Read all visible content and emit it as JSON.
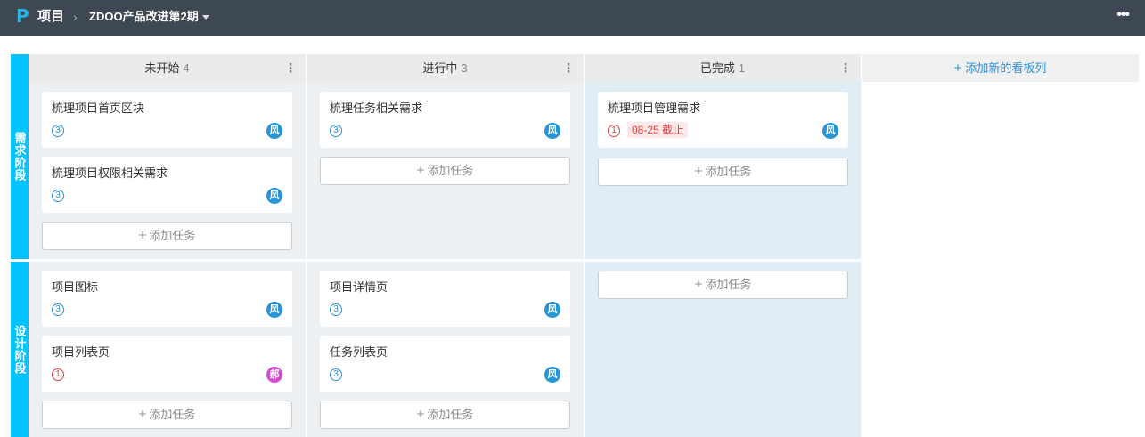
{
  "topbar": {
    "logo": "P",
    "title": "项目",
    "separator": "›",
    "project": "ZDOO产品改进第2期",
    "more": "•••"
  },
  "columns": [
    {
      "name": "未开始",
      "count": "4",
      "menu": "⋮"
    },
    {
      "name": "进行中",
      "count": "3",
      "menu": "⋮"
    },
    {
      "name": "已完成",
      "count": "1",
      "menu": "⋮"
    }
  ],
  "add_column": "添加新的看板列",
  "add_task_label": "添加任务",
  "lanes": [
    {
      "name": "需求阶段",
      "cells": [
        {
          "cards": [
            {
              "title": "梳理项目首页区块",
              "priority": "3",
              "avatar": "风"
            },
            {
              "title": "梳理项目权限相关需求",
              "priority": "3",
              "avatar": "风"
            }
          ]
        },
        {
          "cards": [
            {
              "title": "梳理任务相关需求",
              "priority": "3",
              "avatar": "风"
            }
          ]
        },
        {
          "cards": [
            {
              "title": "梳理项目管理需求",
              "priority": "1",
              "deadline": "08-25 截止",
              "avatar": "风"
            }
          ]
        }
      ]
    },
    {
      "name": "设计阶段",
      "cells": [
        {
          "cards": [
            {
              "title": "项目图标",
              "priority": "3",
              "avatar": "风"
            },
            {
              "title": "项目列表页",
              "priority": "1",
              "avatar": "郝"
            }
          ]
        },
        {
          "cards": [
            {
              "title": "项目详情页",
              "priority": "3",
              "avatar": "风"
            },
            {
              "title": "任务列表页",
              "priority": "3",
              "avatar": "风"
            }
          ]
        },
        {
          "cards": []
        }
      ]
    }
  ],
  "colors": {
    "topbar": "#3d4852",
    "lane_label": "#00c3ff",
    "accent_blue": "#2e8fd6",
    "danger": "#e43d3d",
    "avatar_blue": "#2796d8",
    "avatar_pink": "#d34bd3"
  }
}
